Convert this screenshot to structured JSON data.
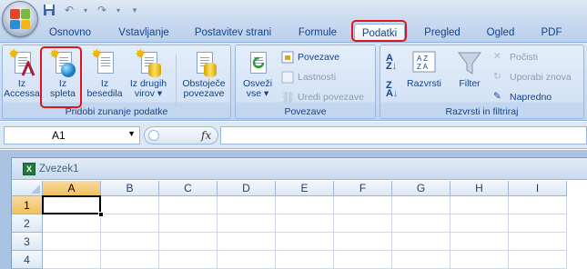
{
  "quick_access": {
    "icons": [
      "save-icon",
      "undo-icon",
      "redo-icon",
      "customize-icon"
    ]
  },
  "tabs": [
    "Osnovno",
    "Vstavljanje",
    "Postavitev strani",
    "Formule",
    "Podatki",
    "Pregled",
    "Ogled",
    "PDF"
  ],
  "active_tab": "Podatki",
  "groups": {
    "external": {
      "label": "Pridobi zunanje podatke",
      "buttons": [
        {
          "line1": "Iz",
          "line2": "Accessa"
        },
        {
          "line1": "Iz",
          "line2": "spleta"
        },
        {
          "line1": "Iz",
          "line2": "besedila"
        },
        {
          "line1": "Iz drugih",
          "line2": "virov ▾"
        },
        {
          "line1": "Obstoječe",
          "line2": "povezave"
        }
      ]
    },
    "connections": {
      "label": "Povezave",
      "refresh": {
        "line1": "Osveži",
        "line2": "vse ▾"
      },
      "povezave": "Povezave",
      "lastnosti": "Lastnosti",
      "uredi": "Uredi povezave"
    },
    "sort": {
      "label": "Razvrsti in filtriraj",
      "razvrsti": "Razvrsti",
      "filter": "Filter",
      "pocisti": "Počisti",
      "uporabi": "Uporabi znova",
      "napredno": "Napredno"
    }
  },
  "formula_bar": {
    "name_box": "A1",
    "fx": "fx",
    "formula": ""
  },
  "workbook": {
    "title": "Zvezek1",
    "columns": [
      "A",
      "B",
      "C",
      "D",
      "E",
      "F",
      "G",
      "H",
      "I"
    ],
    "rows": [
      "1",
      "2",
      "3",
      "4"
    ],
    "active_cell": "A1"
  },
  "colors": {
    "accent": "#15428b",
    "highlight": "#e0141e",
    "selected_header": "#f1c15f"
  }
}
